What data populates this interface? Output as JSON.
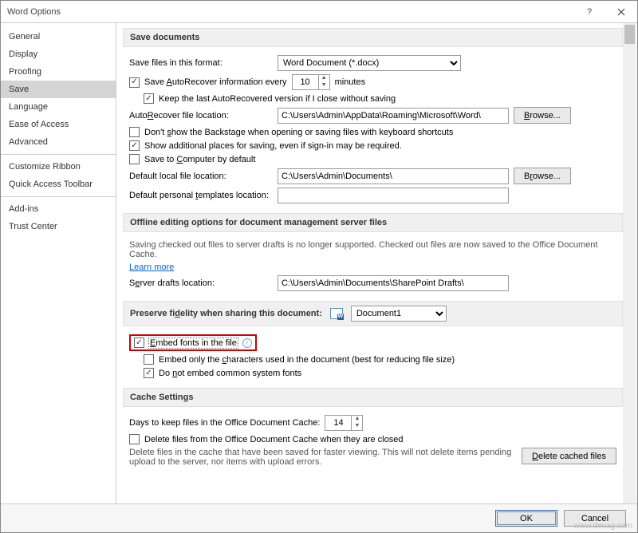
{
  "title": "Word Options",
  "sidebar": {
    "items": [
      {
        "label": "General"
      },
      {
        "label": "Display"
      },
      {
        "label": "Proofing"
      },
      {
        "label": "Save",
        "selected": true
      },
      {
        "label": "Language"
      },
      {
        "label": "Ease of Access"
      },
      {
        "label": "Advanced"
      },
      {
        "label": "Customize Ribbon"
      },
      {
        "label": "Quick Access Toolbar"
      },
      {
        "label": "Add-ins"
      },
      {
        "label": "Trust Center"
      }
    ]
  },
  "save_docs": {
    "header": "Save documents",
    "format_label": "Save files in this format:",
    "format_value": "Word Document (*.docx)",
    "autorecover_label_pre": "Save AutoRecover information every",
    "autorecover_value": "10",
    "autorecover_label_post": "minutes",
    "keeplast_label": "Keep the last AutoRecovered version if I close without saving",
    "location_label": "AutoRecover file location:",
    "location_value": "C:\\Users\\Admin\\AppData\\Roaming\\Microsoft\\Word\\",
    "browse": "Browse...",
    "backstage_label": "Don't show the Backstage when opening or saving files with keyboard shortcuts",
    "additional_label": "Show additional places for saving, even if sign-in may be required.",
    "savecomputer_label": "Save to Computer by default",
    "default_loc_label": "Default local file location:",
    "default_loc_value": "C:\\Users\\Admin\\Documents\\",
    "default_tpl_label": "Default personal templates location:",
    "default_tpl_value": ""
  },
  "offline": {
    "header": "Offline editing options for document management server files",
    "note": "Saving checked out files to server drafts is no longer supported. Checked out files are now saved to the Office Document Cache.",
    "learn_more": "Learn more",
    "drafts_label": "Server drafts location:",
    "drafts_value": "C:\\Users\\Admin\\Documents\\SharePoint Drafts\\"
  },
  "preserve": {
    "header": "Preserve fidelity when sharing this document:",
    "doc_value": "Document1",
    "embed_label": "Embed fonts in the file",
    "embed_only_label": "Embed only the characters used in the document (best for reducing file size)",
    "noembed_common_label": "Do not embed common system fonts"
  },
  "cache": {
    "header": "Cache Settings",
    "days_label": "Days to keep files in the Office Document Cache:",
    "days_value": "14",
    "delete_closed_label": "Delete files from the Office Document Cache when they are closed",
    "note": "Delete files in the cache that have been saved for faster viewing. This will not delete items pending upload to the server, nor items with upload errors.",
    "delete_btn": "Delete cached files"
  },
  "footer": {
    "ok": "OK",
    "cancel": "Cancel"
  },
  "watermark": "www.deuag.com"
}
